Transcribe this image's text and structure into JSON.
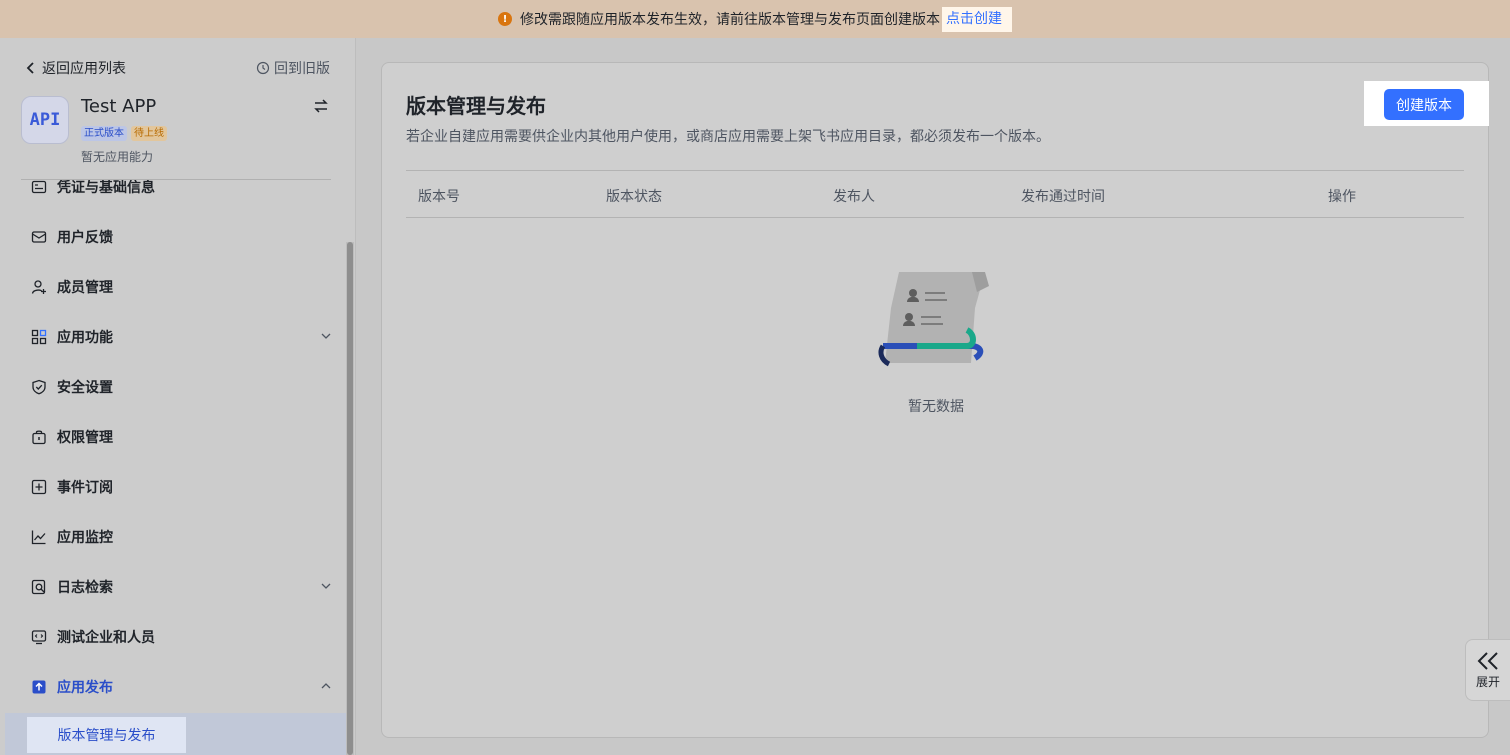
{
  "banner": {
    "message": "修改需跟随应用版本发布生效，请前往版本管理与发布页面创建版本",
    "link": "点击创建"
  },
  "sidebar": {
    "back_label": "返回应用列表",
    "old_label": "回到旧版",
    "app": {
      "logo": "API",
      "name": "Test APP",
      "badge_prod": "正式版本",
      "badge_pending": "待上线",
      "subtitle": "暂无应用能力"
    },
    "items": [
      {
        "label": "凭证与基础信息",
        "icon": "credential-icon"
      },
      {
        "label": "用户反馈",
        "icon": "feedback-icon"
      },
      {
        "label": "成员管理",
        "icon": "member-icon"
      },
      {
        "label": "应用功能",
        "icon": "features-icon"
      },
      {
        "label": "安全设置",
        "icon": "shield-icon"
      },
      {
        "label": "权限管理",
        "icon": "permission-icon"
      },
      {
        "label": "事件订阅",
        "icon": "event-icon"
      },
      {
        "label": "应用监控",
        "icon": "monitor-icon"
      },
      {
        "label": "日志检索",
        "icon": "log-search-icon"
      },
      {
        "label": "测试企业和人员",
        "icon": "test-icon"
      },
      {
        "label": "应用发布",
        "icon": "publish-icon"
      }
    ],
    "active_sub": "版本管理与发布"
  },
  "main": {
    "title": "版本管理与发布",
    "description": "若企业自建应用需要供企业内其他用户使用，或商店应用需要上架飞书应用目录，都必须发布一个版本。",
    "create_button": "创建版本",
    "columns": [
      "版本号",
      "版本状态",
      "发布人",
      "发布通过时间",
      "操作"
    ],
    "empty_text": "暂无数据"
  },
  "expand": {
    "label": "展开"
  },
  "colors": {
    "primary": "#3370ff",
    "banner_bg": "#d9c3ae",
    "warning": "#d9750f"
  }
}
